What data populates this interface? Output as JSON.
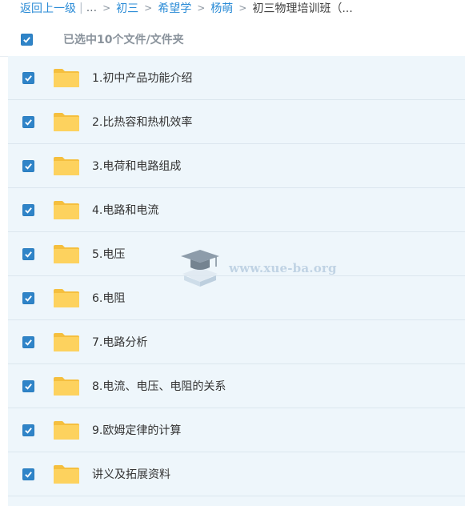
{
  "breadcrumb": {
    "back": "返回上一级",
    "divider": "|",
    "ellipsis": "...",
    "separator": ">",
    "items": [
      "初三",
      "希望学",
      "杨萌"
    ],
    "current": "初三物理培训班（..."
  },
  "selection": {
    "label": "已选中10个文件/文件夹",
    "checked": true
  },
  "files": [
    {
      "name": "1.初中产品功能介绍",
      "checked": true
    },
    {
      "name": "2.比热容和热机效率",
      "checked": true
    },
    {
      "name": "3.电荷和电路组成",
      "checked": true
    },
    {
      "name": "4.电路和电流",
      "checked": true
    },
    {
      "name": "5.电压",
      "checked": true
    },
    {
      "name": "6.电阻",
      "checked": true
    },
    {
      "name": "7.电路分析",
      "checked": true
    },
    {
      "name": "8.电流、电压、电阻的关系",
      "checked": true
    },
    {
      "name": "9.欧姆定律的计算",
      "checked": true
    },
    {
      "name": "讲义及拓展资料",
      "checked": true
    }
  ],
  "watermark": {
    "text": "www.xue-ba.org"
  },
  "colors": {
    "accent": "#2a8bd6",
    "checkbox": "#2f84c8",
    "folder": "#fccf58",
    "list_bg": "#eef6fb"
  }
}
